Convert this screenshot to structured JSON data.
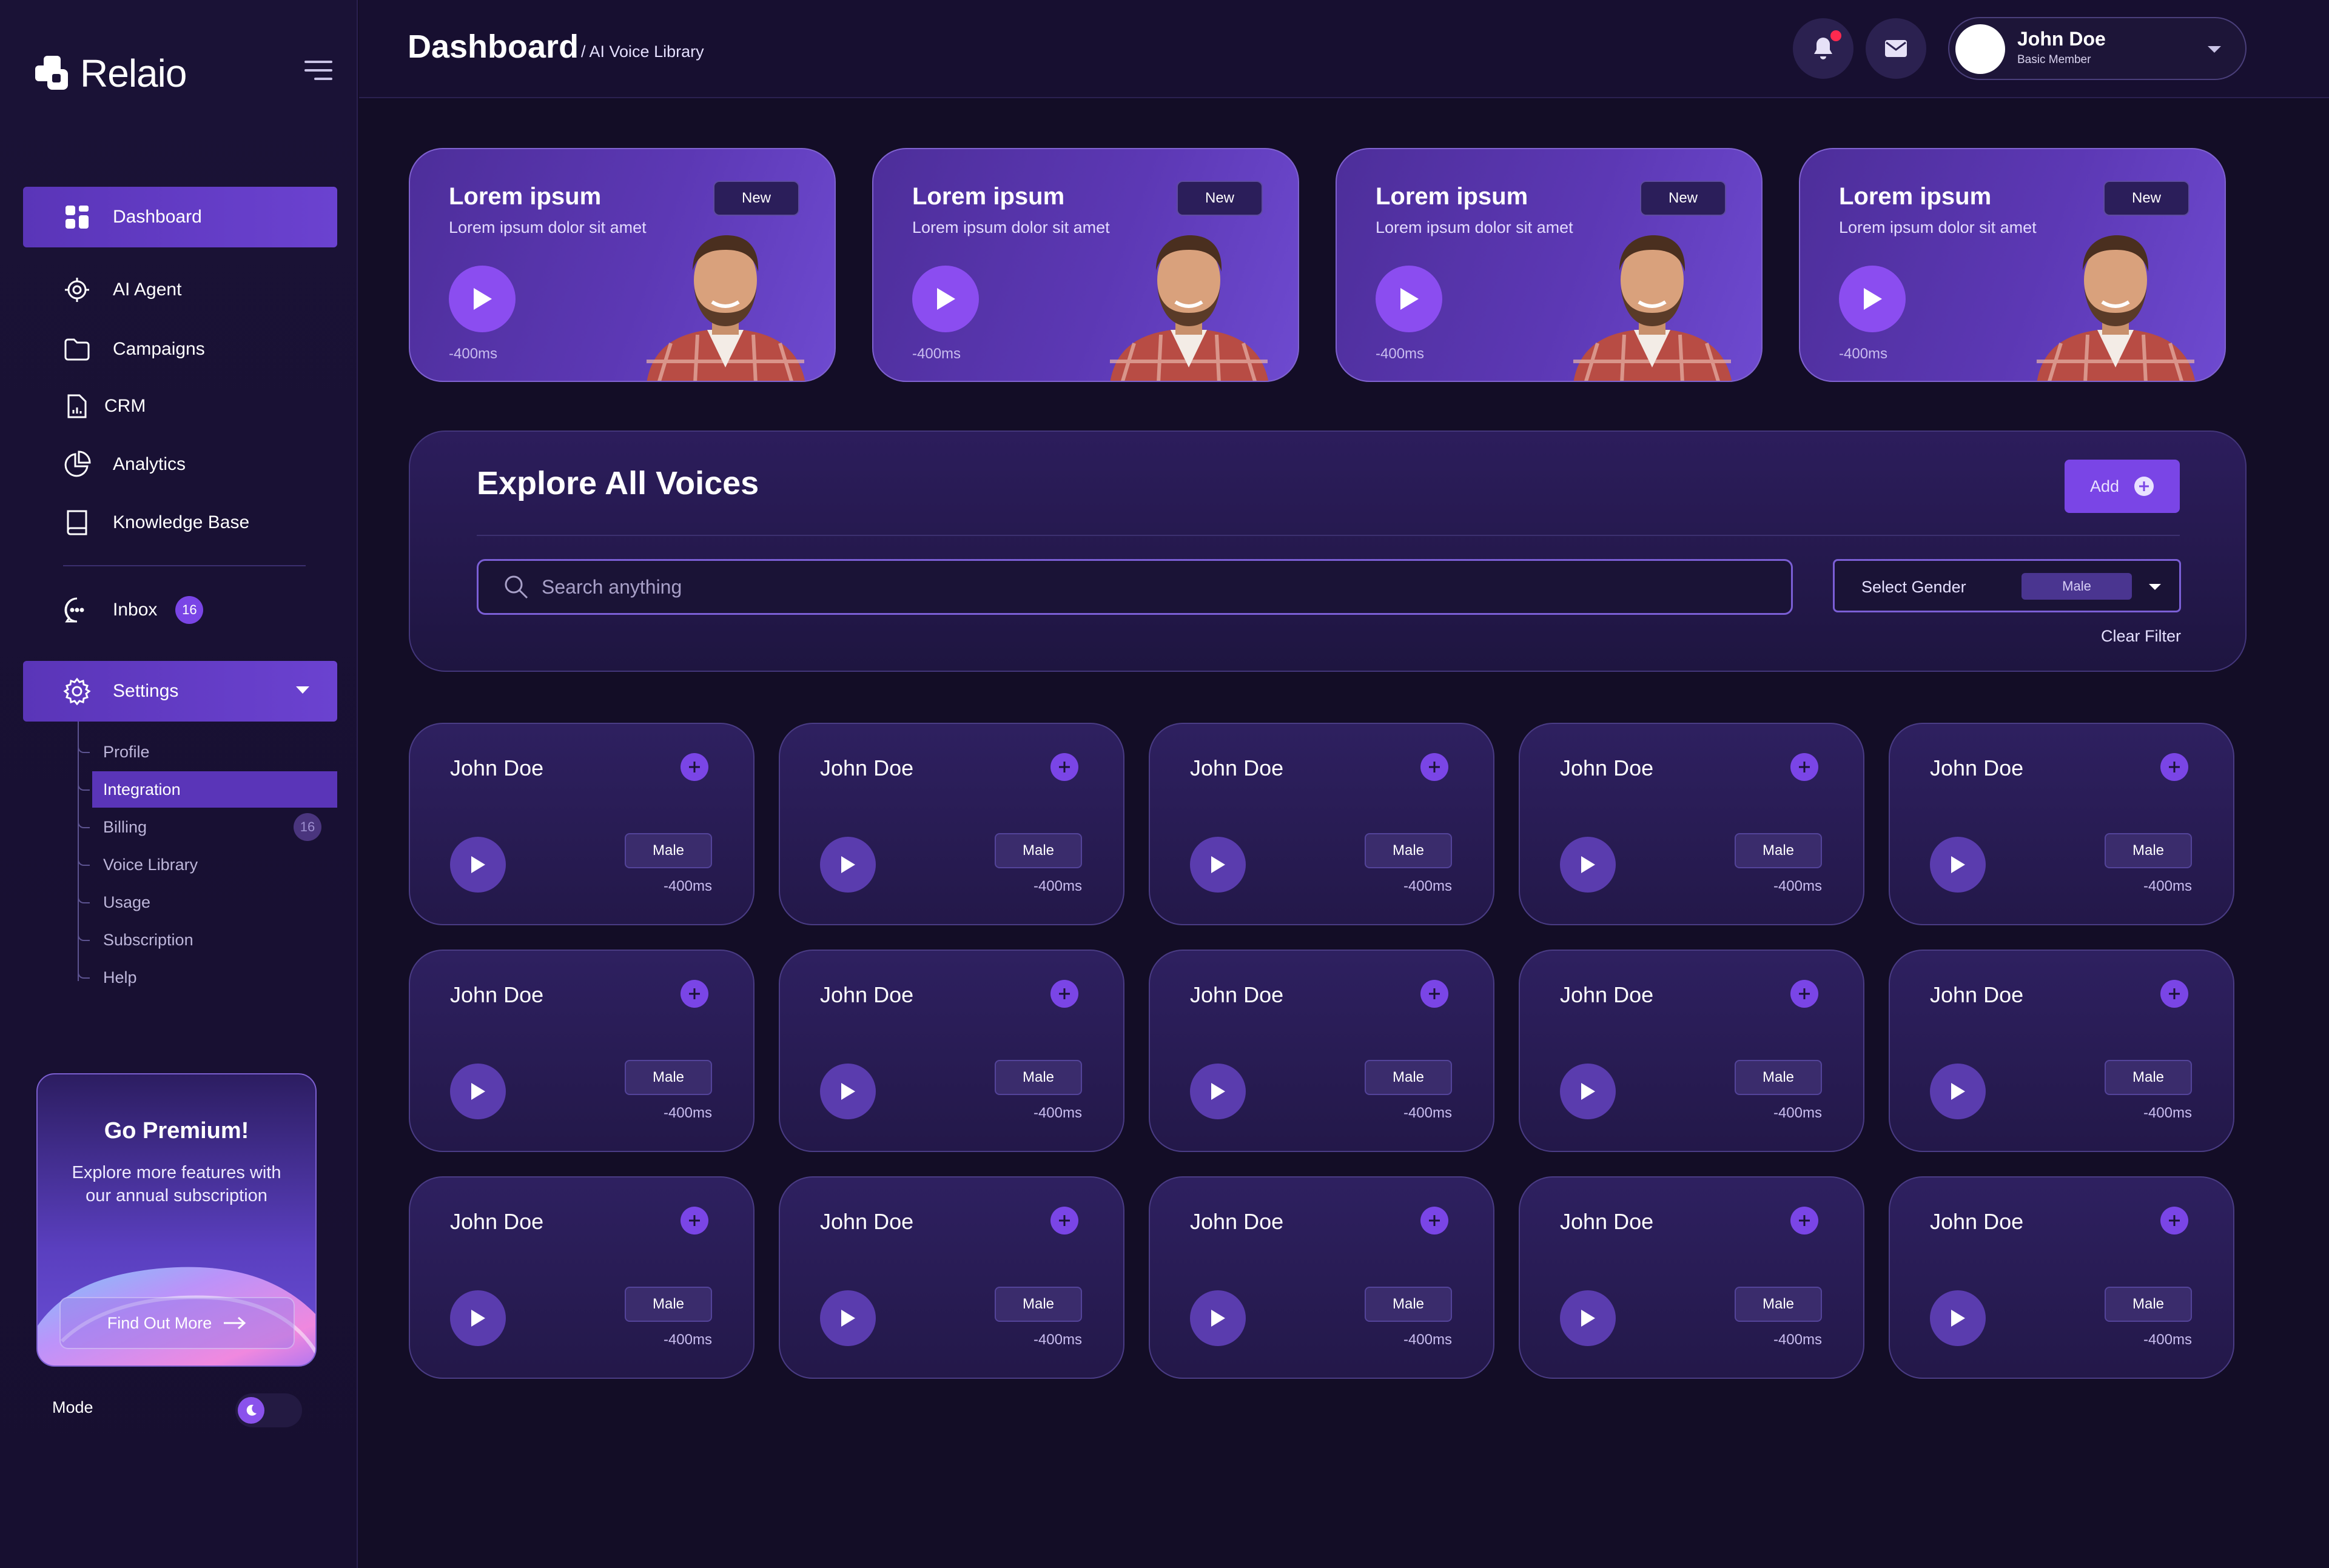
{
  "app": {
    "name": "Relaio"
  },
  "sidebar": {
    "nav": [
      {
        "label": "Dashboard",
        "icon": "dashboard-grid-icon",
        "active": true
      },
      {
        "label": "AI Agent",
        "icon": "ai-agent-icon"
      },
      {
        "label": "Campaigns",
        "icon": "folder-icon"
      },
      {
        "label": "CRM",
        "icon": "document-chart-icon"
      },
      {
        "label": "Analytics",
        "icon": "pie-chart-icon"
      },
      {
        "label": "Knowledge Base",
        "icon": "book-icon"
      }
    ],
    "inbox": {
      "label": "Inbox",
      "badge": "16",
      "icon": "chat-bubble-icon"
    },
    "settings": {
      "label": "Settings",
      "icon": "gear-icon",
      "children": [
        {
          "label": "Profile"
        },
        {
          "label": "Integration",
          "active": true
        },
        {
          "label": "Billing",
          "badge": "16"
        },
        {
          "label": "Voice Library"
        },
        {
          "label": "Usage"
        },
        {
          "label": "Subscription"
        },
        {
          "label": "Help"
        }
      ]
    },
    "premium": {
      "title": "Go Premium!",
      "description": "Explore more features with our annual subscription",
      "button": "Find Out More"
    },
    "mode": {
      "label": "Mode"
    }
  },
  "header": {
    "title": "Dashboard",
    "breadcrumb": "/ AI Voice Library",
    "user": {
      "name": "John Doe",
      "role": "Basic Member"
    }
  },
  "featured": [
    {
      "title": "Lorem ipsum",
      "subtitle": "Lorem ipsum dolor sit amet",
      "tag": "New",
      "duration": "-400ms"
    },
    {
      "title": "Lorem ipsum",
      "subtitle": "Lorem ipsum dolor sit amet",
      "tag": "New",
      "duration": "-400ms"
    },
    {
      "title": "Lorem ipsum",
      "subtitle": "Lorem ipsum dolor sit amet",
      "tag": "New",
      "duration": "-400ms"
    },
    {
      "title": "Lorem ipsum",
      "subtitle": "Lorem ipsum dolor sit amet",
      "tag": "New",
      "duration": "-400ms"
    }
  ],
  "explore": {
    "title": "Explore All Voices",
    "add_label": "Add",
    "search_placeholder": "Search anything",
    "gender_label": "Select Gender",
    "gender_value": "Male",
    "clear_filter": "Clear Filter"
  },
  "voices": [
    {
      "name": "John Doe",
      "gender": "Male",
      "duration": "-400ms"
    },
    {
      "name": "John Doe",
      "gender": "Male",
      "duration": "-400ms"
    },
    {
      "name": "John Doe",
      "gender": "Male",
      "duration": "-400ms"
    },
    {
      "name": "John Doe",
      "gender": "Male",
      "duration": "-400ms"
    },
    {
      "name": "John Doe",
      "gender": "Male",
      "duration": "-400ms"
    },
    {
      "name": "John Doe",
      "gender": "Male",
      "duration": "-400ms"
    },
    {
      "name": "John Doe",
      "gender": "Male",
      "duration": "-400ms"
    },
    {
      "name": "John Doe",
      "gender": "Male",
      "duration": "-400ms"
    },
    {
      "name": "John Doe",
      "gender": "Male",
      "duration": "-400ms"
    },
    {
      "name": "John Doe",
      "gender": "Male",
      "duration": "-400ms"
    },
    {
      "name": "John Doe",
      "gender": "Male",
      "duration": "-400ms"
    },
    {
      "name": "John Doe",
      "gender": "Male",
      "duration": "-400ms"
    },
    {
      "name": "John Doe",
      "gender": "Male",
      "duration": "-400ms"
    },
    {
      "name": "John Doe",
      "gender": "Male",
      "duration": "-400ms"
    },
    {
      "name": "John Doe",
      "gender": "Male",
      "duration": "-400ms"
    }
  ],
  "colors": {
    "accent": "#7a45e6",
    "active_nav": "#5a35b8",
    "background": "#130d26",
    "notification": "#ff2a4f"
  }
}
